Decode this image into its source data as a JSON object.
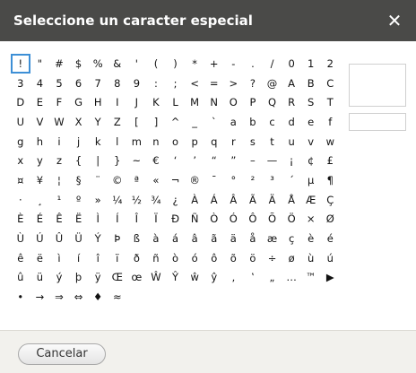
{
  "dialog": {
    "title": "Seleccione un caracter especial",
    "close_label": "✕",
    "cancel_label": "Cancelar"
  },
  "characters": [
    "!",
    "\"",
    "#",
    "$",
    "%",
    "&",
    "'",
    "(",
    ")",
    "*",
    "+",
    "-",
    ".",
    "/",
    "0",
    "1",
    "2",
    "3",
    "4",
    "5",
    "6",
    "7",
    "8",
    "9",
    ":",
    ";",
    "<",
    "=",
    ">",
    "?",
    "@",
    "A",
    "B",
    "C",
    "D",
    "E",
    "F",
    "G",
    "H",
    "I",
    "J",
    "K",
    "L",
    "M",
    "N",
    "O",
    "P",
    "Q",
    "R",
    "S",
    "T",
    "U",
    "V",
    "W",
    "X",
    "Y",
    "Z",
    "[",
    "]",
    "^",
    "_",
    "`",
    "a",
    "b",
    "c",
    "d",
    "e",
    "f",
    "g",
    "h",
    "i",
    "j",
    "k",
    "l",
    "m",
    "n",
    "o",
    "p",
    "q",
    "r",
    "s",
    "t",
    "u",
    "v",
    "w",
    "x",
    "y",
    "z",
    "{",
    "|",
    "}",
    "~",
    "€",
    "‘",
    "’",
    "“",
    "”",
    "–",
    "—",
    "¡",
    "¢",
    "£",
    "¤",
    "¥",
    "¦",
    "§",
    "¨",
    "©",
    "ª",
    "«",
    "¬",
    "®",
    "¯",
    "°",
    "²",
    "³",
    "´",
    "µ",
    "¶",
    "·",
    "¸",
    "¹",
    "º",
    "»",
    "¼",
    "½",
    "¾",
    "¿",
    "À",
    "Á",
    "Â",
    "Ã",
    "Ä",
    "Å",
    "Æ",
    "Ç",
    "È",
    "É",
    "Ê",
    "Ë",
    "Ì",
    "Í",
    "Î",
    "Ï",
    "Ð",
    "Ñ",
    "Ò",
    "Ó",
    "Ô",
    "Õ",
    "Ö",
    "×",
    "Ø",
    "Ù",
    "Ú",
    "Û",
    "Ü",
    "Ý",
    "Þ",
    "ß",
    "à",
    "á",
    "â",
    "ã",
    "ä",
    "å",
    "æ",
    "ç",
    "è",
    "é",
    "ê",
    "ë",
    "ì",
    "í",
    "î",
    "ï",
    "ð",
    "ñ",
    "ò",
    "ó",
    "ô",
    "õ",
    "ö",
    "÷",
    "ø",
    "ù",
    "ú",
    "û",
    "ü",
    "ý",
    "þ",
    "ÿ",
    "Œ",
    "œ",
    "Ŵ",
    "Ŷ",
    "ŵ",
    "ŷ",
    "‚",
    "‛",
    "„",
    "…",
    "™",
    "▶",
    "•",
    "→",
    "⇒",
    "⇔",
    "♦",
    "≈"
  ],
  "selected_character": "!",
  "colors": {
    "titlebar": "#4a4a48",
    "selection_border": "#3d8fd6",
    "footer": "#f2f1ed"
  }
}
